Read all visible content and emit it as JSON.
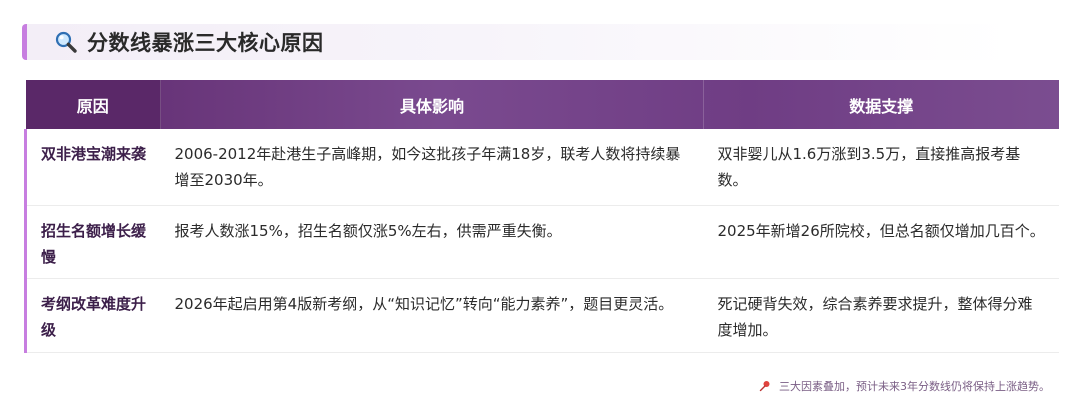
{
  "title": {
    "icon": "magnifier-icon",
    "text": "分数线暴涨三大核心原因"
  },
  "table": {
    "headers": [
      "原因",
      "具体影响",
      "数据支撑"
    ],
    "rows": [
      {
        "reason": "双非港宝潮来袭",
        "impact": "2006-2012年赴港生子高峰期，如今这批孩子年满18岁，联考人数将持续暴增至2030年。",
        "support": "双非婴儿从1.6万涨到3.5万，直接推高报考基数。"
      },
      {
        "reason": "招生名额增长缓慢",
        "impact": "报考人数涨15%，招生名额仅涨5%左右，供需严重失衡。",
        "support": "2025年新增26所院校，但总名额仅增加几百个。"
      },
      {
        "reason": "考纲改革难度升级",
        "impact": "2026年起启用第4版新考纲，从“知识记忆”转向“能力素养”，题目更灵活。",
        "support": "死记硬背失效，综合素养要求提升，整体得分难度增加。"
      }
    ]
  },
  "footnote": {
    "icon": "pushpin-icon",
    "text": "三大因素叠加，预计未来3年分数线仍将保持上涨趋势。"
  },
  "colors": {
    "accent": "#c77ee0",
    "header_dark": "#5a2868",
    "header_mid": "#7a4a8f"
  }
}
